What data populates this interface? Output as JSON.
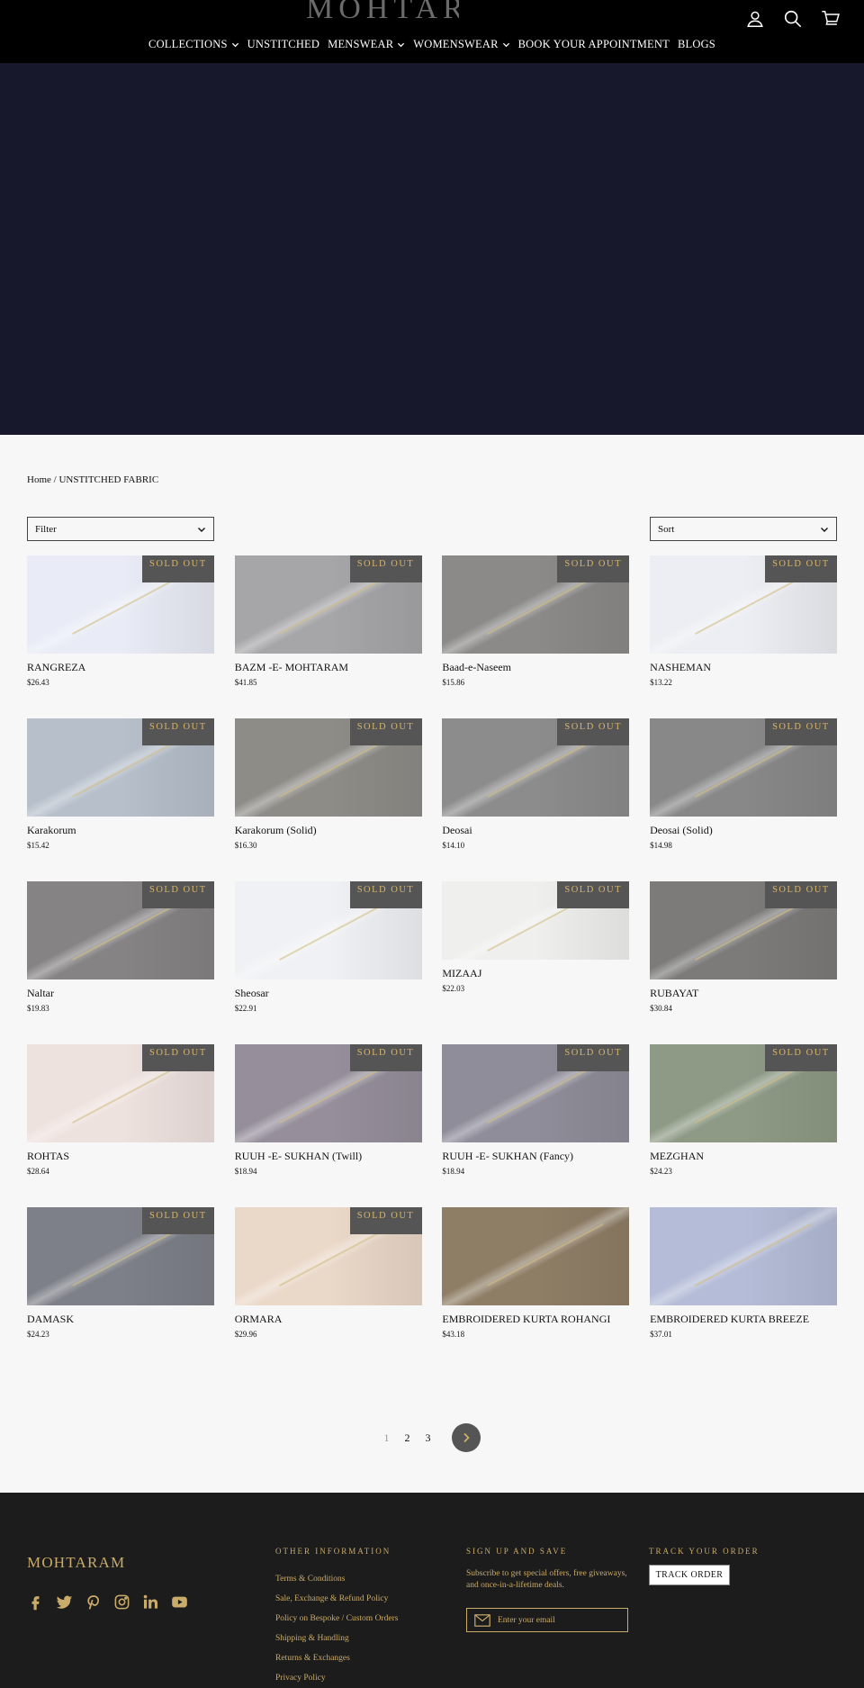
{
  "header": {
    "logo_text": "MOHTARAM",
    "icons": [
      "account-icon",
      "search-icon",
      "cart-icon"
    ],
    "nav": [
      {
        "label": "COLLECTIONS",
        "has_dropdown": true
      },
      {
        "label": "UNSTITCHED",
        "has_dropdown": false
      },
      {
        "label": "MENSWEAR",
        "has_dropdown": true
      },
      {
        "label": "WOMENSWEAR",
        "has_dropdown": true
      },
      {
        "label": "BOOK YOUR APPOINTMENT",
        "has_dropdown": false
      },
      {
        "label": "BLOGS",
        "has_dropdown": false
      }
    ]
  },
  "breadcrumb": {
    "home": "Home",
    "separator": "/",
    "current": "UNSTITCHED FABRIC"
  },
  "filter": {
    "label": "Filter"
  },
  "sort": {
    "label": "Sort"
  },
  "sold_out_label": "SOLD OUT",
  "products": [
    {
      "title": "RANGREZA",
      "price": "$26.43",
      "sold_out": true,
      "color": "#e9ecf6"
    },
    {
      "title": "BAZM -E- MOHTARAM",
      "price": "$41.85",
      "sold_out": true,
      "color": "#a6a6a8"
    },
    {
      "title": "Baad-e-Naseem",
      "price": "$15.86",
      "sold_out": true,
      "color": "#8b8a89"
    },
    {
      "title": "NASHEMAN",
      "price": "$13.22",
      "sold_out": true,
      "color": "#eceef3"
    },
    {
      "title": "Karakorum",
      "price": "$15.42",
      "sold_out": true,
      "color": "#b6bfca"
    },
    {
      "title": "Karakorum (Solid)",
      "price": "$16.30",
      "sold_out": true,
      "color": "#8e8c87"
    },
    {
      "title": "Deosai",
      "price": "$14.10",
      "sold_out": true,
      "color": "#8c8c8c"
    },
    {
      "title": "Deosai (Solid)",
      "price": "$14.98",
      "sold_out": true,
      "color": "#888888"
    },
    {
      "title": "Naltar",
      "price": "$19.83",
      "sold_out": true,
      "color": "#858384"
    },
    {
      "title": "Sheosar",
      "price": "$22.91",
      "sold_out": true,
      "color": "#f0f1f4"
    },
    {
      "title": "MIZAAJ",
      "price": "$22.03",
      "sold_out": true,
      "color": "#efefee"
    },
    {
      "title": "RUBAYAT",
      "price": "$30.84",
      "sold_out": true,
      "color": "#7c7b7a"
    },
    {
      "title": "ROHTAS",
      "price": "$28.64",
      "sold_out": true,
      "color": "#eee2df"
    },
    {
      "title": "RUUH -E- SUKHAN (Twill)",
      "price": "$18.94",
      "sold_out": true,
      "color": "#968f9b"
    },
    {
      "title": "RUUH -E- SUKHAN (Fancy)",
      "price": "$18.94",
      "sold_out": true,
      "color": "#8f8d99"
    },
    {
      "title": "MEZGHAN",
      "price": "$24.23",
      "sold_out": true,
      "color": "#8e9a85"
    },
    {
      "title": "DAMASK",
      "price": "$24.23",
      "sold_out": true,
      "color": "#7d8088"
    },
    {
      "title": "ORMARA",
      "price": "$29.96",
      "sold_out": true,
      "color": "#ead8c8"
    },
    {
      "title": "EMBROIDERED KURTA ROHANGI",
      "price": "$43.18",
      "sold_out": false,
      "color": "#8f7e66"
    },
    {
      "title": "EMBROIDERED KURTA BREEZE",
      "price": "$37.01",
      "sold_out": false,
      "color": "#b4bcd7"
    }
  ],
  "pagination": {
    "pages": [
      "1",
      "2",
      "3"
    ],
    "current": "1"
  },
  "footer": {
    "brand": "MOHTARAM",
    "socials": [
      "facebook-icon",
      "twitter-icon",
      "pinterest-icon",
      "instagram-icon",
      "linkedin-icon",
      "youtube-icon"
    ],
    "other_info": {
      "heading": "OTHER INFORMATION",
      "links": [
        "Terms & Conditions",
        "Sale, Exchange & Refund Policy",
        "Policy on Bespoke / Custom Orders",
        "Shipping & Handling",
        "Returns & Exchanges",
        "Privacy Policy"
      ]
    },
    "signup": {
      "heading": "SIGN UP AND SAVE",
      "text": "Subscribe to get special offers, free giveaways, and once-in-a-lifetime deals.",
      "placeholder": "Enter your email"
    },
    "track": {
      "heading": "TRACK YOUR ORDER",
      "button": "TRACK ORDER"
    }
  },
  "colors": {
    "header_bg": "#000000",
    "hero_bg": "#17182b",
    "accent_gold": "#c9ab6a",
    "footer_bg": "#1c1c1c"
  }
}
